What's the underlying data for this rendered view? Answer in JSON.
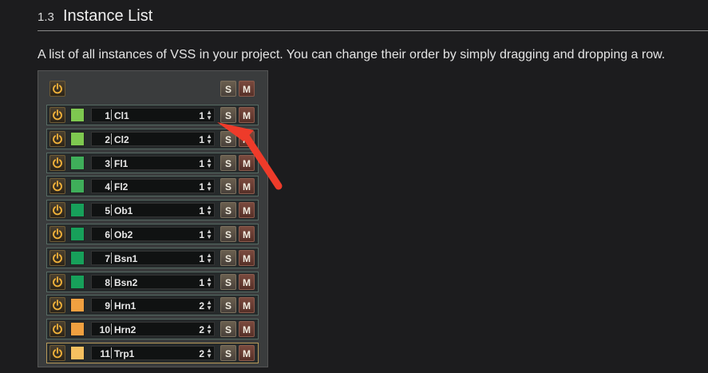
{
  "section": {
    "number": "1.3",
    "title": "Instance List"
  },
  "description": "A list of all instances of VSS in your project. You can change their order by simply dragging and dropping a row.",
  "panel": {
    "solo_label": "S",
    "mute_label": "M",
    "rows": [
      {
        "index": "1",
        "name": "Cl1",
        "midi": "1",
        "color": "#7ec850",
        "active": false
      },
      {
        "index": "2",
        "name": "Cl2",
        "midi": "1",
        "color": "#7ec850",
        "active": false
      },
      {
        "index": "3",
        "name": "Fl1",
        "midi": "1",
        "color": "#3fae5a",
        "active": false
      },
      {
        "index": "4",
        "name": "Fl2",
        "midi": "1",
        "color": "#3fae5a",
        "active": false
      },
      {
        "index": "5",
        "name": "Ob1",
        "midi": "1",
        "color": "#17a05a",
        "active": false
      },
      {
        "index": "6",
        "name": "Ob2",
        "midi": "1",
        "color": "#17a05a",
        "active": false
      },
      {
        "index": "7",
        "name": "Bsn1",
        "midi": "1",
        "color": "#17a05a",
        "active": false
      },
      {
        "index": "8",
        "name": "Bsn2",
        "midi": "1",
        "color": "#17a05a",
        "active": false
      },
      {
        "index": "9",
        "name": "Hrn1",
        "midi": "2",
        "color": "#f0a040",
        "active": false
      },
      {
        "index": "10",
        "name": "Hrn2",
        "midi": "2",
        "color": "#f0a040",
        "active": false
      },
      {
        "index": "11",
        "name": "Trp1",
        "midi": "2",
        "color": "#f5c060",
        "active": true
      }
    ]
  },
  "icons": {
    "power": "power-icon",
    "arrow": "red-arrow-annotation"
  },
  "colors": {
    "power": "#f2b33a",
    "arrow": "#ee3b2a"
  }
}
